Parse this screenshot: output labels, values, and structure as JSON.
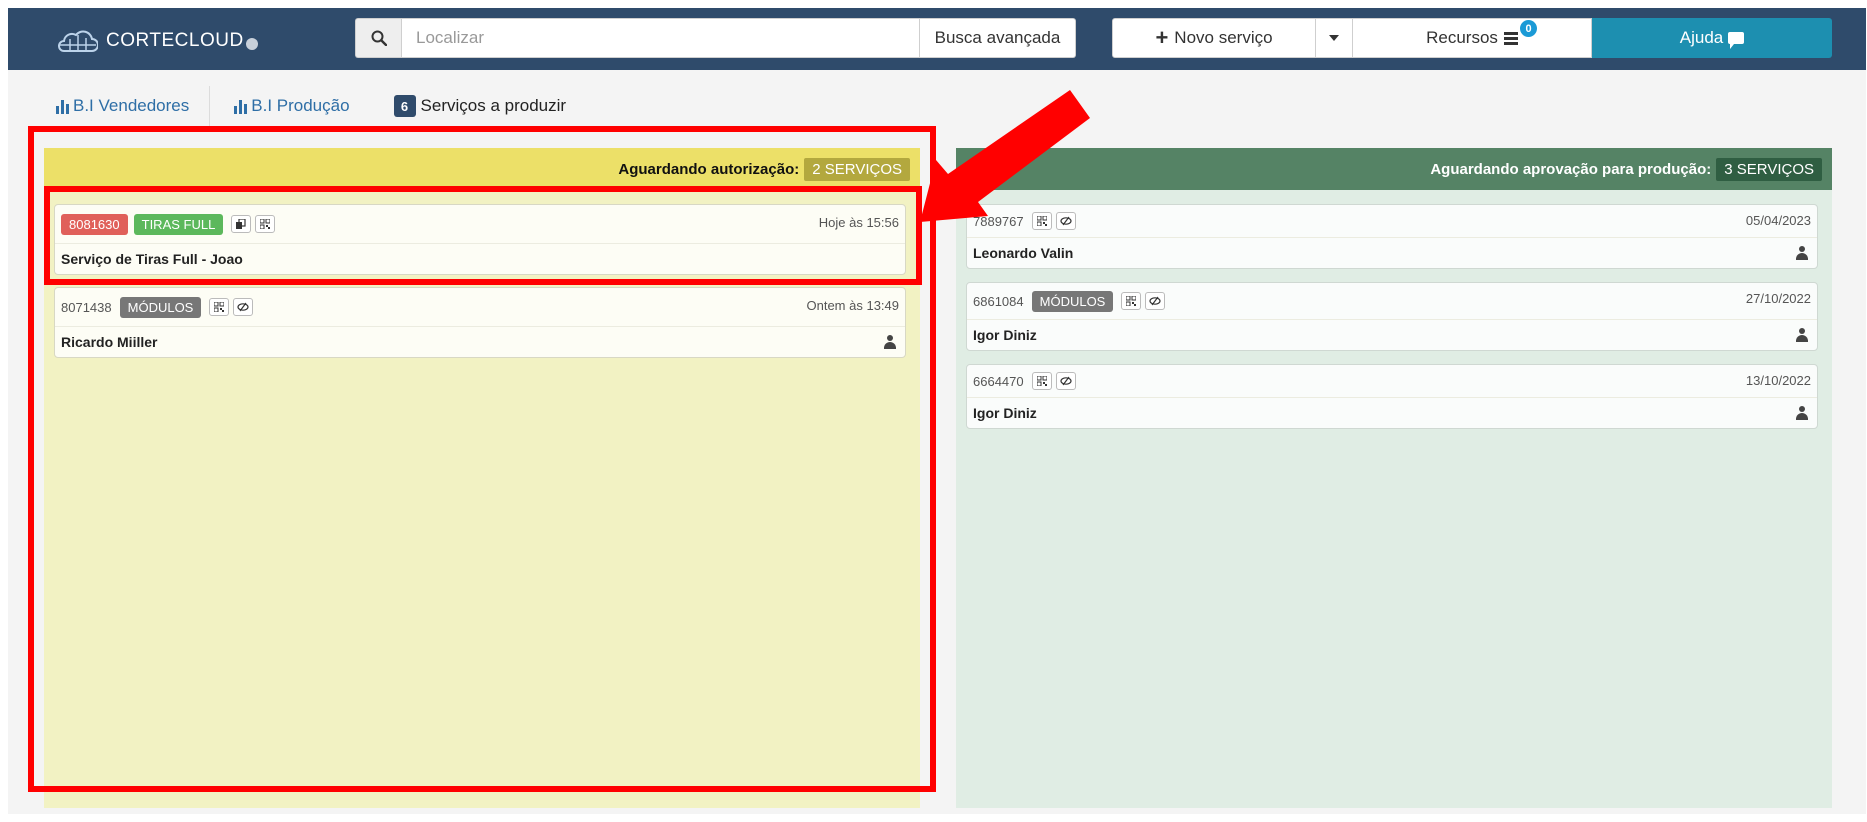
{
  "header": {
    "logo_text": "CORTECLOUD",
    "search": {
      "placeholder": "Localizar",
      "advanced_label": "Busca avançada"
    },
    "new_service_label": "Novo serviço",
    "resources_label": "Recursos",
    "resources_badge": "0",
    "help_label": "Ajuda"
  },
  "tabs": [
    {
      "label": "B.I Vendedores"
    },
    {
      "label": "B.I Produção"
    },
    {
      "label": "Serviços a produzir",
      "count": "6"
    }
  ],
  "columns": [
    {
      "title": "Aguardando autorização:",
      "badge": "2 SERVIÇOS",
      "cards": [
        {
          "number": "8081630",
          "tag": "TIRAS FULL",
          "date": "Hoje às 15:56",
          "title": "Serviço de Tiras Full - Joao"
        },
        {
          "number": "8071438",
          "tag": "MÓDULOS",
          "date": "Ontem às 13:49",
          "title": "Ricardo Miiller"
        }
      ]
    },
    {
      "title": "Aguardando aprovação para produção:",
      "badge": "3 SERVIÇOS",
      "cards": [
        {
          "number": "7889767",
          "date": "05/04/2023",
          "title": "Leonardo Valin"
        },
        {
          "number": "6861084",
          "tag": "MÓDULOS",
          "date": "27/10/2022",
          "title": "Igor Diniz"
        },
        {
          "number": "6664470",
          "date": "13/10/2022",
          "title": "Igor Diniz"
        }
      ]
    }
  ],
  "colors": {
    "topbar": "#2f4b6b",
    "help_button": "#1d8fb0",
    "yellow_column": "#f2f2c3",
    "green_column": "#e0ede4",
    "annotation": "#ff0000"
  }
}
